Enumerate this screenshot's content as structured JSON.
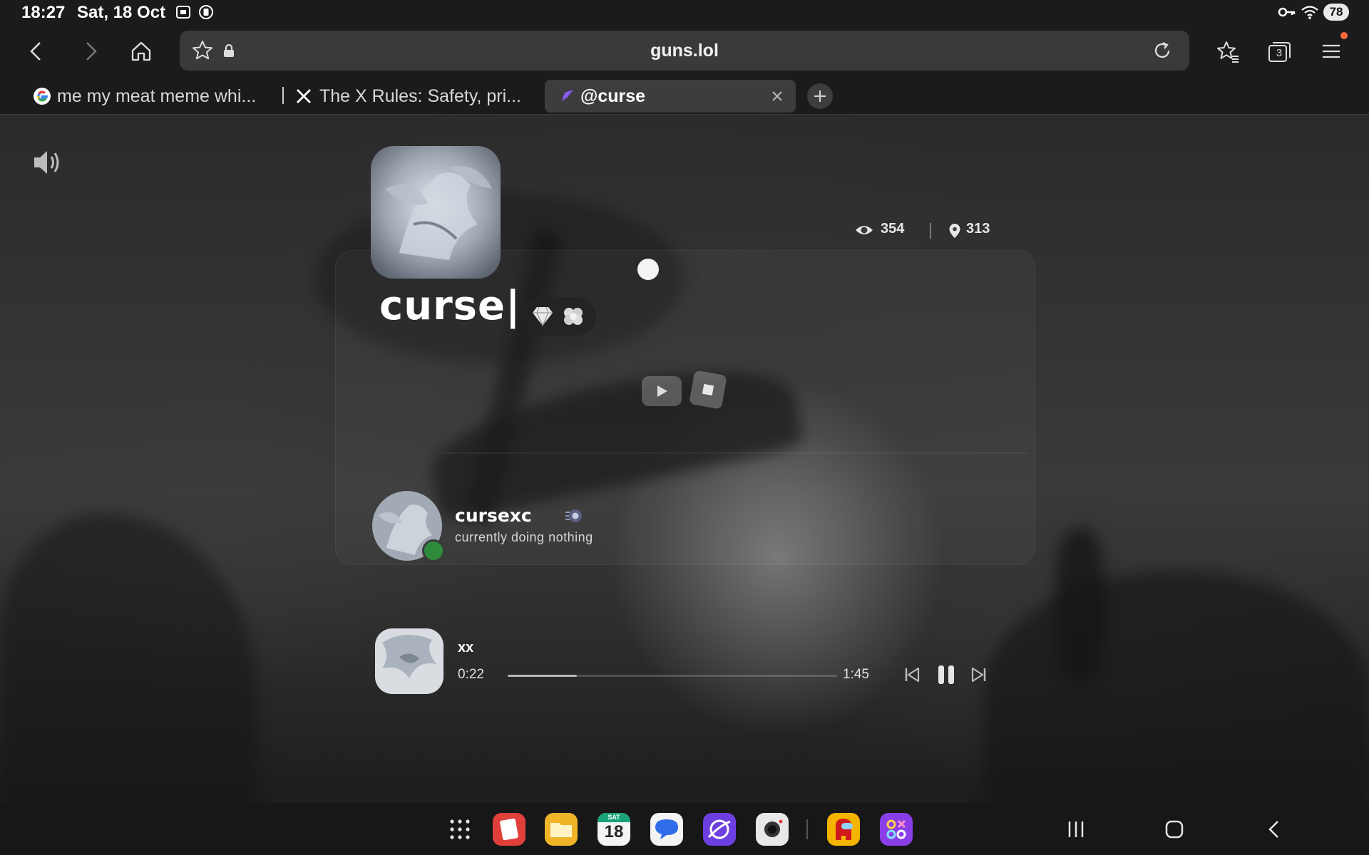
{
  "status_bar": {
    "time": "18:27",
    "date": "Sat, 18 Oct",
    "battery": "78"
  },
  "browser": {
    "url": "guns.lol",
    "tabs_count": "3",
    "tabs": [
      {
        "title": "me my meat meme whi...",
        "icon": "google-icon"
      },
      {
        "title": "The X Rules: Safety, pri...",
        "icon": "x-logo-icon"
      },
      {
        "title": "@curse",
        "icon": "guns-lol-icon",
        "active": true
      }
    ]
  },
  "profile": {
    "username": "curse|",
    "views": "354",
    "location_count": "313",
    "accent": "#ffffff"
  },
  "discord": {
    "name": "cursexc",
    "status": "currently doing nothing",
    "presence_color": "#2e8b3c"
  },
  "music": {
    "title": "xx",
    "current_time": "0:22",
    "total_time": "1:45",
    "progress": 0.21
  },
  "taskbar": {
    "calendar_day": "18",
    "calendar_weekday": "SAT",
    "apps": [
      "apps-grid-icon",
      "notes-icon",
      "files-icon",
      "calendar-icon",
      "messages-icon",
      "browser-icon",
      "camera-icon",
      "among-us-icon",
      "game-icon"
    ]
  }
}
